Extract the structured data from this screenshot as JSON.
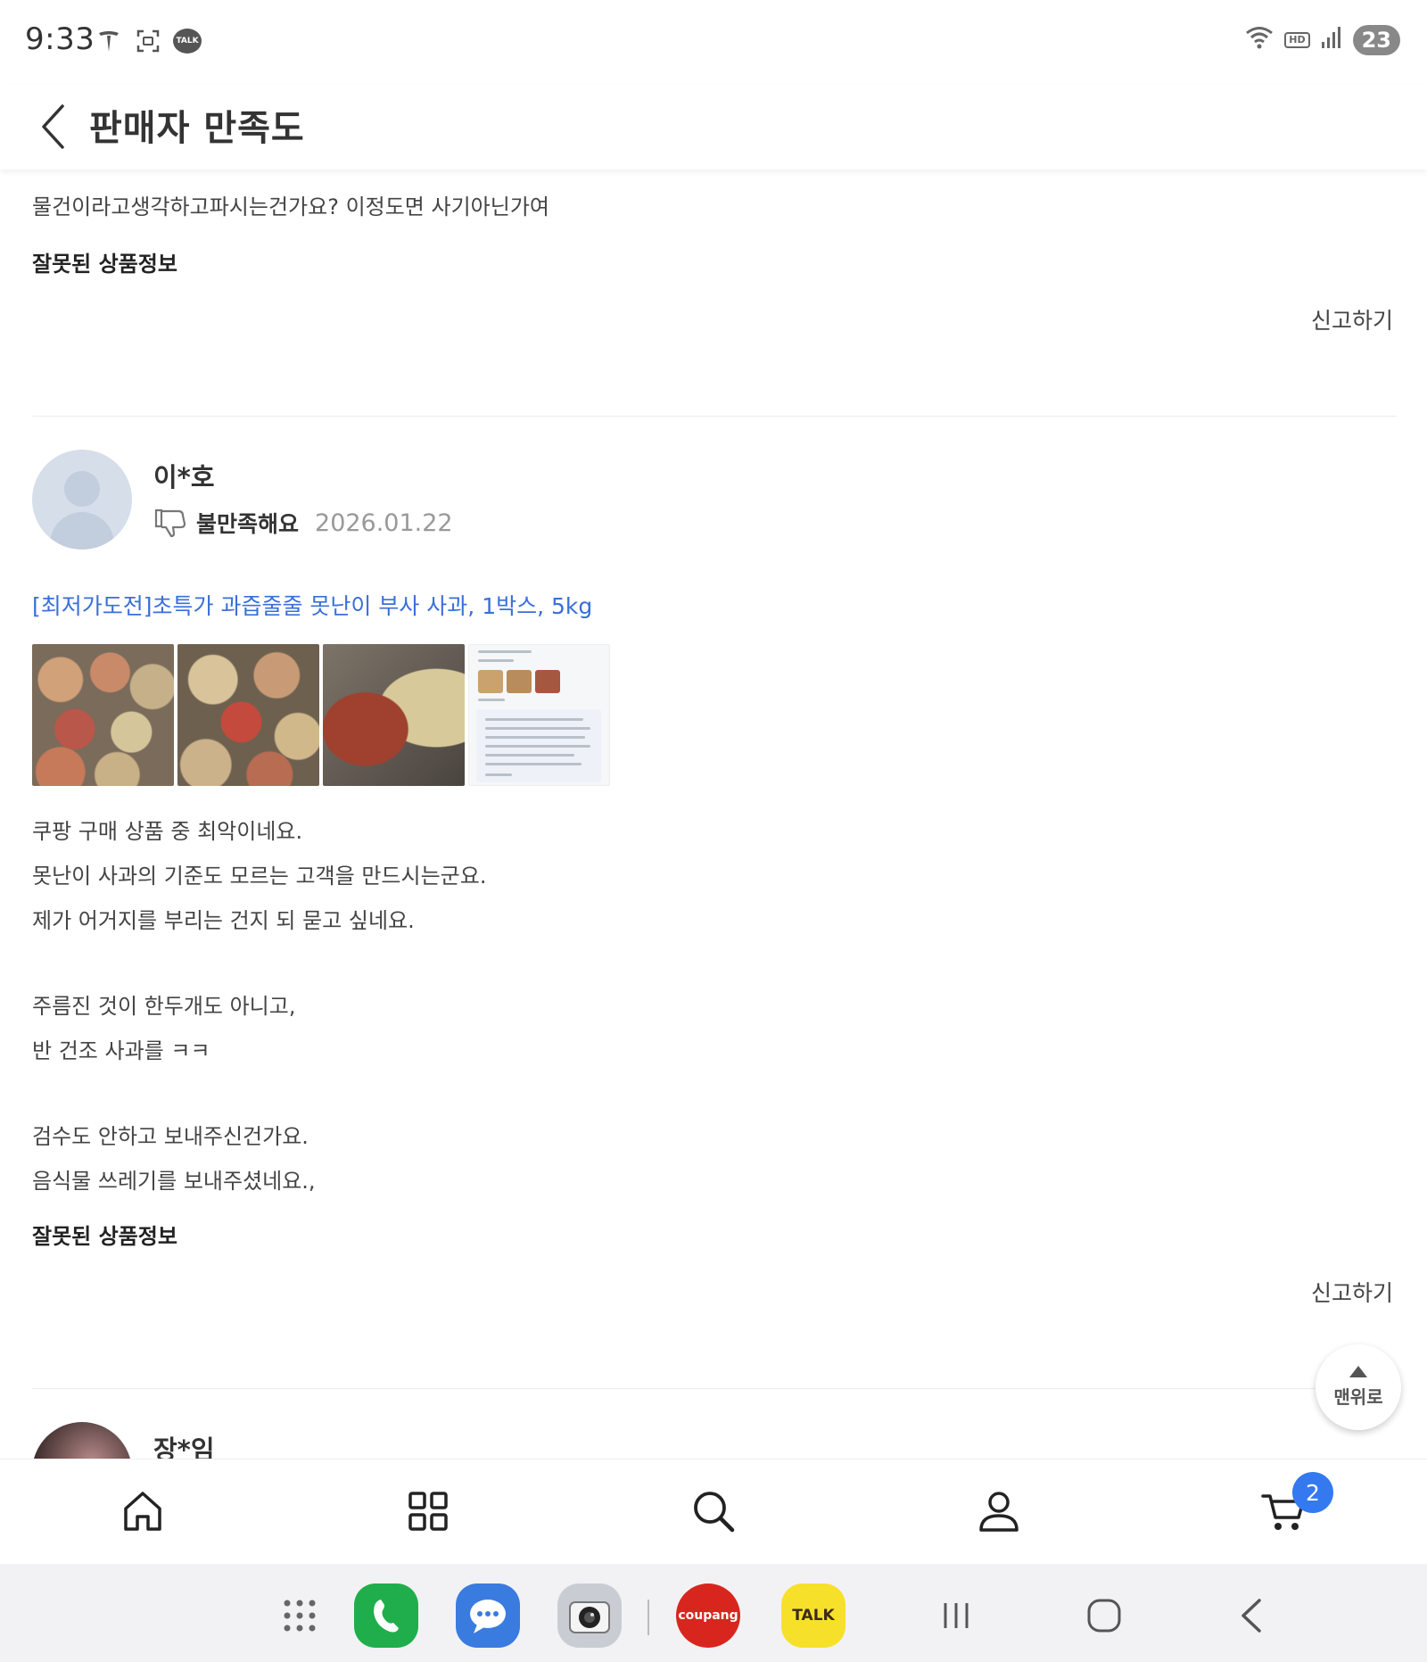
{
  "status_bar": {
    "time": "9:33",
    "left_icons": [
      "tesla-icon",
      "screenshot-icon",
      "kakaotalk-notification-icon"
    ],
    "talk_label": "TALK",
    "right_icons": [
      "wifi-icon",
      "hd-voice-icon",
      "signal-icon",
      "battery-icon"
    ],
    "hd_label": "HD",
    "battery": "23"
  },
  "header": {
    "title": "판매자 만족도"
  },
  "reviews": [
    {
      "text_lines": [
        "물건이라고생각하고파시는건가요? 이정도면 사기아닌가여"
      ],
      "tag": "잘못된 상품정보",
      "report_label": "신고하기"
    },
    {
      "reviewer": "이*호",
      "rating_label": "불만족해요",
      "date": "2026.01.22",
      "product": "[최저가도전]초특가 과즙줄줄 못난이 부사 사과, 1박스, 5kg",
      "text_lines": [
        "쿠팡 구매 상품 중 최악이네요.",
        "못난이 사과의 기준도 모르는 고객을 만드시는군요.",
        "제가 어거지를 부리는 건지 되 묻고 싶네요.",
        "",
        "주름진 것이 한두개도 아니고,",
        "반 건조 사과를 ㅋㅋ",
        "",
        "검수도 안하고 보내주신건가요.",
        "음식물 쓰레기를 보내주셨네요.,"
      ],
      "tag": "잘못된 상품정보",
      "report_label": "신고하기"
    },
    {
      "reviewer": "장*임"
    }
  ],
  "back_to_top": "맨위로",
  "bottom_nav": {
    "items": [
      "home-icon",
      "category-icon",
      "search-icon",
      "mypage-icon",
      "cart-icon"
    ],
    "cart_count": "2"
  },
  "dock": {
    "apps": [
      "app-drawer-icon",
      "phone-icon",
      "messages-icon",
      "camera-icon",
      "coupang-icon",
      "kakaotalk-icon"
    ],
    "coupang_label": "coupang",
    "kakao_label": "TALK",
    "system_buttons": [
      "recent-apps-icon",
      "home-button-icon",
      "back-icon"
    ]
  },
  "colors": {
    "link": "#3a6fd8",
    "cart_badge": "#3479f0",
    "phone_app": "#1fae4b",
    "messages_app": "#3a7be0",
    "kakao_app": "#f7e02a",
    "coupang_app": "#d8261f"
  }
}
